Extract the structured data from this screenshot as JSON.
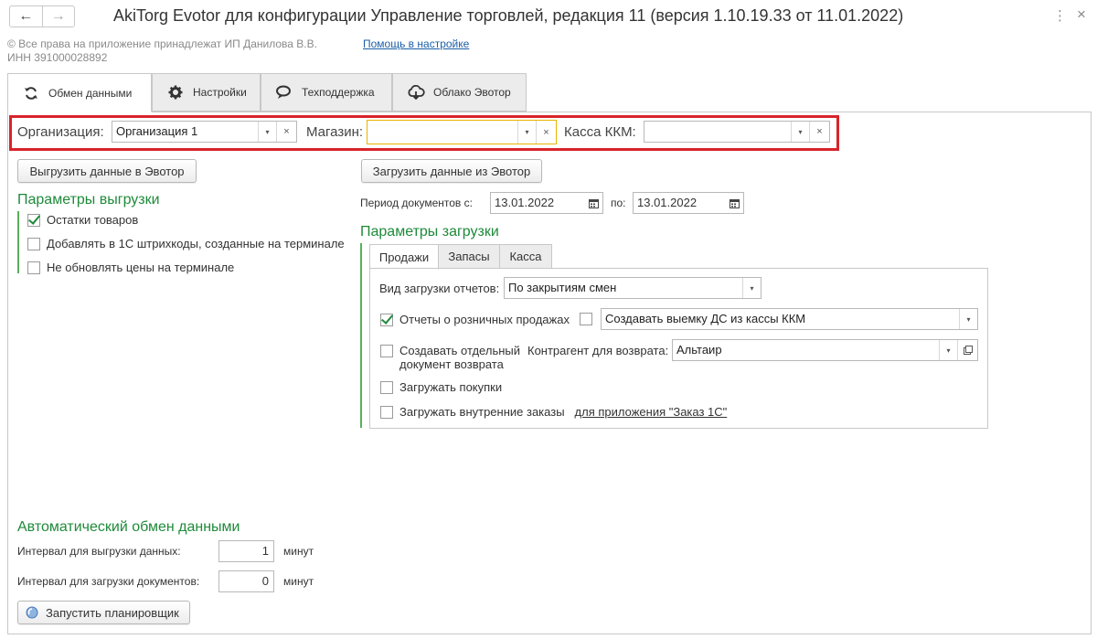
{
  "window": {
    "title": "AkiTorg Evotor для конфигурации Управление торговлей, редакция 11 (версия 1.10.19.33 от 11.01.2022)",
    "back_icon": "←",
    "forward_icon": "→",
    "menu_icon": "⋮",
    "close_icon": "×"
  },
  "header": {
    "copyright_line1": "© Все права на приложение принадлежат ИП Данилова В.В.",
    "copyright_line2": "ИНН 391000028892",
    "help_link": "Помощь в настройке"
  },
  "tabs": [
    {
      "label": "Обмен данными",
      "icon": "refresh-icon",
      "active": true
    },
    {
      "label": "Настройки",
      "icon": "gear-icon",
      "active": false
    },
    {
      "label": "Техподдержка",
      "icon": "chat-icon",
      "active": false
    },
    {
      "label": "Облако Эвотор",
      "icon": "cloud-icon",
      "active": false
    }
  ],
  "filters": {
    "org_label": "Организация:",
    "org_value": "Организация 1",
    "store_label": "Магазин:",
    "store_value": "",
    "kkm_label": "Касса ККМ:",
    "kkm_value": "",
    "clear_glyph": "×",
    "dropdown_glyph": "▾",
    "highlight_color": "#d8232a"
  },
  "export": {
    "button": "Выгрузить данные в Эвотор",
    "section_title": "Параметры выгрузки",
    "options": [
      {
        "label": "Остатки товаров",
        "checked": true
      },
      {
        "label": "Добавлять в 1С штрихкоды, созданные на терминале",
        "checked": false
      },
      {
        "label": "Не обновлять цены на терминале",
        "checked": false
      }
    ]
  },
  "import": {
    "button": "Загрузить данные из Эвотор",
    "period_label": "Период  документов с:",
    "date_from": "13.01.2022",
    "to_label": "по:",
    "date_to": "13.01.2022",
    "section_title": "Параметры загрузки",
    "subtabs": [
      {
        "label": "Продажи",
        "active": true
      },
      {
        "label": "Запасы",
        "active": false
      },
      {
        "label": "Касса",
        "active": false
      }
    ],
    "report_type_label": "Вид загрузки отчетов:",
    "report_type_value": "По закрытиям смен",
    "retail_reports_label": "Отчеты о розничных продажах",
    "retail_reports_checked": true,
    "withdrawal_checked": false,
    "withdrawal_value": "Создавать выемку ДС из кассы ККМ",
    "separate_return_label_1": "Создавать отдельный",
    "separate_return_label_2": "документ возврата",
    "separate_return_checked": false,
    "counterparty_label": "Контрагент для возврата:",
    "counterparty_value": "Альтаир",
    "purchases_label": "Загружать покупки",
    "purchases_checked": false,
    "internal_orders_label": "Загружать внутренние заказы",
    "internal_orders_checked": false,
    "internal_orders_link": "для приложения \"Заказ 1С\""
  },
  "auto": {
    "section_title": "Автоматический обмен данными",
    "export_interval_label": "Интервал для выгрузки данных:",
    "export_interval_value": "1",
    "import_interval_label": "Интервал для загрузки документов:",
    "import_interval_value": "0",
    "unit": "минут",
    "scheduler_button": "Запустить планировщик"
  },
  "colors": {
    "section_green": "#1e8a3a",
    "link_blue": "#1b5fa8",
    "focus_yellow": "#e8b400"
  }
}
